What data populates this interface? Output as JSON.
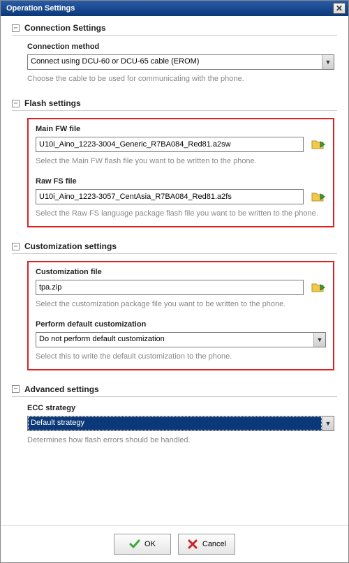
{
  "window": {
    "title": "Operation Settings"
  },
  "sections": {
    "connection": {
      "title": "Connection Settings",
      "method_label": "Connection method",
      "method_value": "Connect using DCU-60 or DCU-65 cable (EROM)",
      "method_help": "Choose the cable to be used for communicating with the phone."
    },
    "flash": {
      "title": "Flash settings",
      "main_fw_label": "Main FW file",
      "main_fw_value": "U10i_Aino_1223-3004_Generic_R7BA084_Red81.a2sw",
      "main_fw_help": "Select the Main FW flash file you want to be written to the phone.",
      "raw_fs_label": "Raw FS file",
      "raw_fs_value": "U10i_Aino_1223-3057_CentAsia_R7BA084_Red81.a2fs",
      "raw_fs_help": "Select the Raw FS language package flash file you want to be written to the phone."
    },
    "customization": {
      "title": "Customization settings",
      "file_label": "Customization file",
      "file_value": "tpa.zip",
      "file_help": "Select the customization package file you want to be written to the phone.",
      "perform_label": "Perform default customization",
      "perform_value": "Do not perform default customization",
      "perform_help": "Select this to write the default customization to the phone."
    },
    "advanced": {
      "title": "Advanced settings",
      "ecc_label": "ECC strategy",
      "ecc_value": "Default strategy",
      "ecc_help": "Determines how flash errors should be handled."
    }
  },
  "buttons": {
    "ok": "OK",
    "cancel": "Cancel"
  },
  "glyphs": {
    "collapse": "−",
    "dropdown": "▼"
  }
}
